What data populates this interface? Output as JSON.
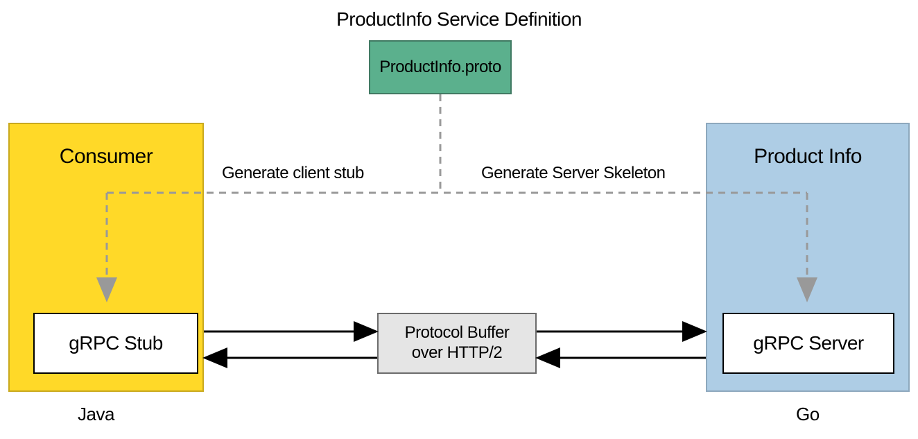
{
  "title": "ProductInfo Service Definition",
  "proto_label": "ProductInfo.proto",
  "consumer": {
    "title": "Consumer",
    "stub": "gRPC Stub",
    "language": "Java"
  },
  "product_info": {
    "title": "Product Info",
    "server": "gRPC Server",
    "language": "Go"
  },
  "protocol": {
    "line1": "Protocol Buffer",
    "line2": "over HTTP/2"
  },
  "labels": {
    "gen_client": "Generate client stub",
    "gen_server": "Generate Server Skeleton"
  }
}
